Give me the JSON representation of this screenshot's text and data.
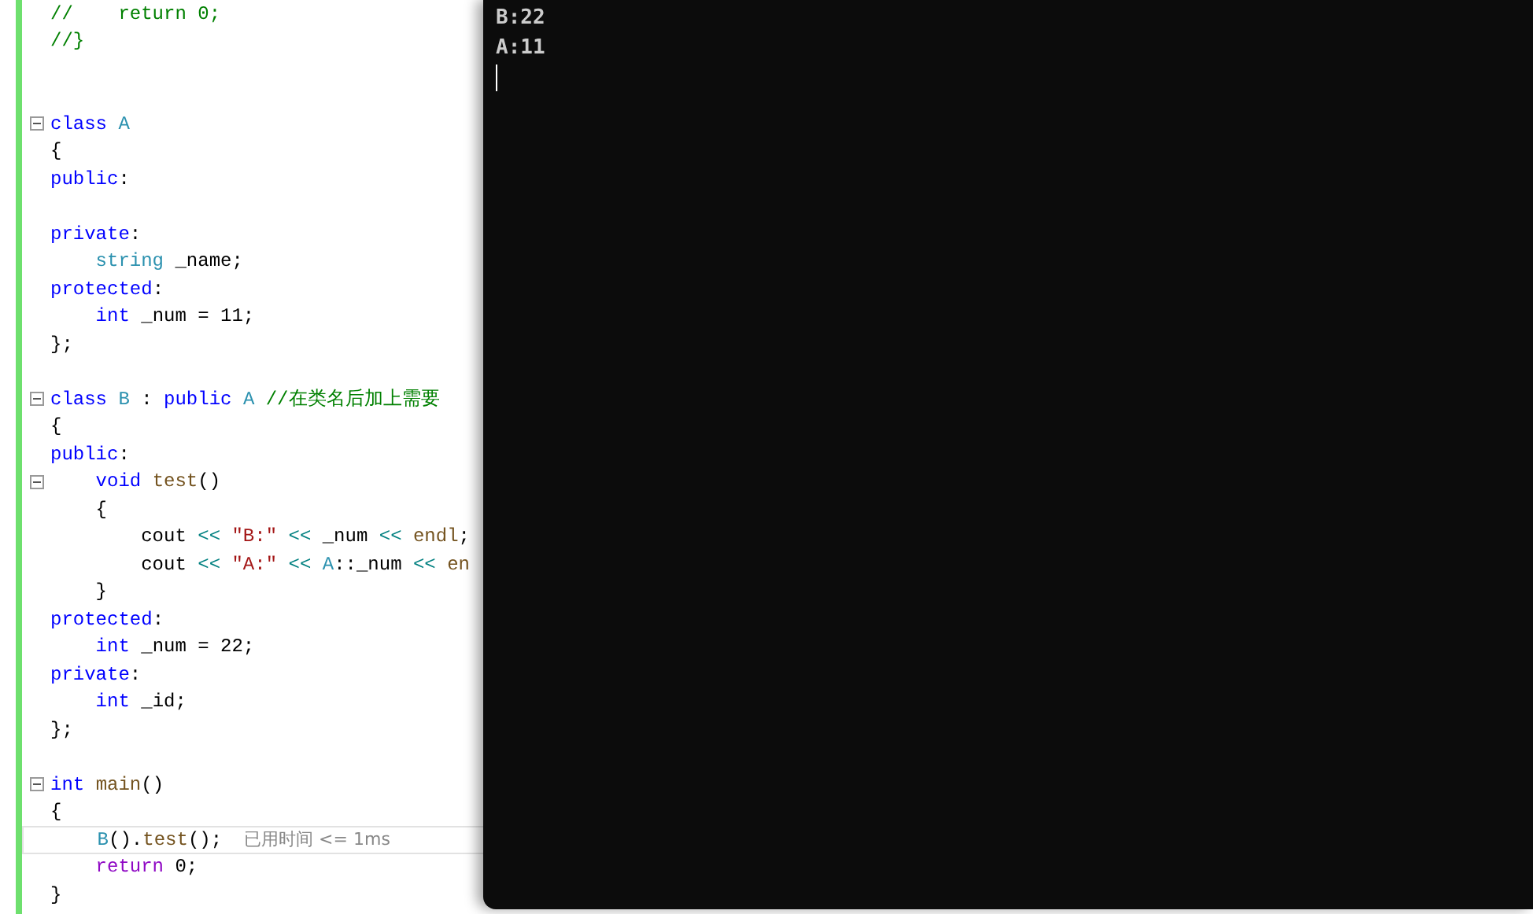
{
  "editor": {
    "lines": [
      {
        "kind": "code",
        "tokens": [
          {
            "t": "//    return 0;",
            "kind": "comment"
          }
        ]
      },
      {
        "kind": "code",
        "tokens": [
          {
            "t": "//}",
            "kind": "comment"
          }
        ]
      },
      {
        "kind": "code"
      },
      {
        "kind": "code"
      },
      {
        "kind": "fold_start",
        "tokens": [
          {
            "t": "class ",
            "kind": "keyword"
          },
          {
            "t": "A",
            "kind": "type"
          }
        ]
      },
      {
        "kind": "code",
        "tokens": [
          {
            "t": "{",
            "kind": "plain"
          }
        ]
      },
      {
        "kind": "code",
        "tokens": [
          {
            "t": "public",
            "kind": "keyword"
          },
          {
            "t": ":",
            "kind": "plain"
          }
        ]
      },
      {
        "kind": "code"
      },
      {
        "kind": "code",
        "tokens": [
          {
            "t": "private",
            "kind": "keyword"
          },
          {
            "t": ":",
            "kind": "plain"
          }
        ]
      },
      {
        "kind": "code",
        "tokens": [
          {
            "t": "    string",
            "kind": "type"
          },
          {
            "t": " _name;",
            "kind": "plain"
          }
        ]
      },
      {
        "kind": "code",
        "tokens": [
          {
            "t": "protected",
            "kind": "keyword"
          },
          {
            "t": ":",
            "kind": "plain"
          }
        ]
      },
      {
        "kind": "code",
        "tokens": [
          {
            "t": "    int",
            "kind": "keyword"
          },
          {
            "t": " _num = 11;",
            "kind": "plain"
          }
        ]
      },
      {
        "kind": "code",
        "tokens": [
          {
            "t": "};",
            "kind": "plain"
          }
        ]
      },
      {
        "kind": "code"
      },
      {
        "kind": "fold_start",
        "tokens": [
          {
            "t": "class ",
            "kind": "keyword"
          },
          {
            "t": "B",
            "kind": "type"
          },
          {
            "t": " : ",
            "kind": "plain"
          },
          {
            "t": "public ",
            "kind": "keyword"
          },
          {
            "t": "A ",
            "kind": "type"
          },
          {
            "t": "//在类名后加上需要",
            "kind": "comment"
          }
        ]
      },
      {
        "kind": "code",
        "tokens": [
          {
            "t": "{",
            "kind": "plain"
          }
        ]
      },
      {
        "kind": "code",
        "tokens": [
          {
            "t": "public",
            "kind": "keyword"
          },
          {
            "t": ":",
            "kind": "plain"
          }
        ]
      },
      {
        "kind": "fold_start",
        "tokens": [
          {
            "t": "    void ",
            "kind": "keyword"
          },
          {
            "t": "test",
            "kind": "function"
          },
          {
            "t": "()",
            "kind": "plain"
          }
        ]
      },
      {
        "kind": "code",
        "tokens": [
          {
            "t": "    {",
            "kind": "plain"
          }
        ]
      },
      {
        "kind": "code",
        "tokens": [
          {
            "t": "        cout ",
            "kind": "plain"
          },
          {
            "t": "<< ",
            "kind": "operator"
          },
          {
            "t": "\"B:\" ",
            "kind": "string"
          },
          {
            "t": "<<",
            "kind": "operator"
          },
          {
            "t": " _num ",
            "kind": "plain"
          },
          {
            "t": "<< ",
            "kind": "operator"
          },
          {
            "t": "endl",
            "kind": "function"
          },
          {
            "t": ";",
            "kind": "plain"
          }
        ]
      },
      {
        "kind": "code",
        "tokens": [
          {
            "t": "        cout ",
            "kind": "plain"
          },
          {
            "t": "<< ",
            "kind": "operator"
          },
          {
            "t": "\"A:\" ",
            "kind": "string"
          },
          {
            "t": "<< ",
            "kind": "operator"
          },
          {
            "t": "A",
            "kind": "type"
          },
          {
            "t": "::_num ",
            "kind": "plain"
          },
          {
            "t": "<< ",
            "kind": "operator"
          },
          {
            "t": "en",
            "kind": "function"
          }
        ]
      },
      {
        "kind": "code",
        "tokens": [
          {
            "t": "    }",
            "kind": "plain"
          }
        ]
      },
      {
        "kind": "code",
        "tokens": [
          {
            "t": "protected",
            "kind": "keyword"
          },
          {
            "t": ":",
            "kind": "plain"
          }
        ]
      },
      {
        "kind": "code",
        "tokens": [
          {
            "t": "    int",
            "kind": "keyword"
          },
          {
            "t": " _num = 22;",
            "kind": "plain"
          }
        ]
      },
      {
        "kind": "code",
        "tokens": [
          {
            "t": "private",
            "kind": "keyword"
          },
          {
            "t": ":",
            "kind": "plain"
          }
        ]
      },
      {
        "kind": "code",
        "tokens": [
          {
            "t": "    int",
            "kind": "keyword"
          },
          {
            "t": " _id;",
            "kind": "plain"
          }
        ]
      },
      {
        "kind": "code",
        "tokens": [
          {
            "t": "};",
            "kind": "plain"
          }
        ]
      },
      {
        "kind": "code"
      },
      {
        "kind": "fold_start",
        "tokens": [
          {
            "t": "int ",
            "kind": "keyword"
          },
          {
            "t": "main",
            "kind": "function"
          },
          {
            "t": "()",
            "kind": "plain"
          }
        ]
      },
      {
        "kind": "code",
        "tokens": [
          {
            "t": "{",
            "kind": "plain"
          }
        ]
      },
      {
        "kind": "current",
        "hint": "已用时间 <= 1ms",
        "tokens": [
          {
            "t": "    B",
            "kind": "type"
          },
          {
            "t": "().",
            "kind": "plain"
          },
          {
            "t": "test",
            "kind": "function"
          },
          {
            "t": "();",
            "kind": "plain"
          }
        ]
      },
      {
        "kind": "code",
        "tokens": [
          {
            "t": "    return",
            "kind": "control"
          },
          {
            "t": " 0;",
            "kind": "plain"
          }
        ]
      },
      {
        "kind": "code",
        "tokens": [
          {
            "t": "}",
            "kind": "plain"
          }
        ]
      }
    ]
  },
  "console": {
    "lines": [
      "B:22",
      "A:11"
    ]
  }
}
